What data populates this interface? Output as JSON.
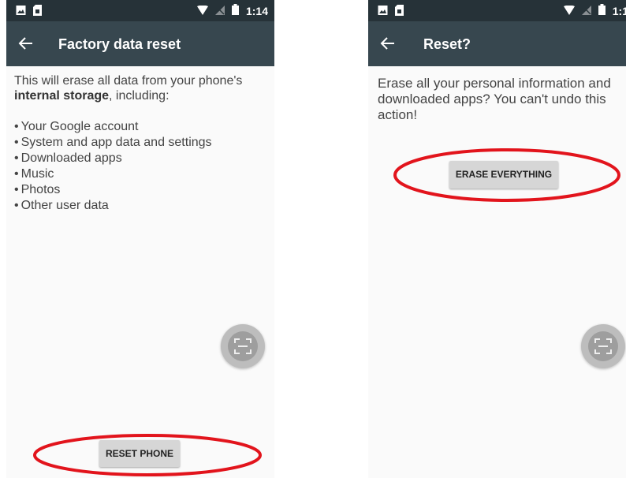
{
  "left_screen": {
    "status_bar": {
      "time": "1:14"
    },
    "app_bar": {
      "title": "Factory data reset"
    },
    "intro_text": "This will erase all data from your phone's",
    "intro_bold": "internal storage",
    "intro_suffix": ", including:",
    "bullets": [
      "Your Google account",
      "System and app data and settings",
      "Downloaded apps",
      "Music",
      "Photos",
      "Other user data"
    ],
    "reset_button_label": "RESET PHONE"
  },
  "right_screen": {
    "status_bar": {
      "time": "1:1"
    },
    "app_bar": {
      "title": "Reset?"
    },
    "message": "Erase all your personal information and downloaded apps? You can't undo this action!",
    "erase_button_label": "ERASE EVERYTHING"
  },
  "colors": {
    "status_bar": "#263238",
    "app_bar": "#37474f",
    "background": "#fafafa",
    "highlight": "#e2141c"
  },
  "icons": [
    "image-icon",
    "sim-icon",
    "wifi-icon",
    "no-signal-icon",
    "battery-icon",
    "back-arrow-icon",
    "screenshot-fab-icon"
  ]
}
